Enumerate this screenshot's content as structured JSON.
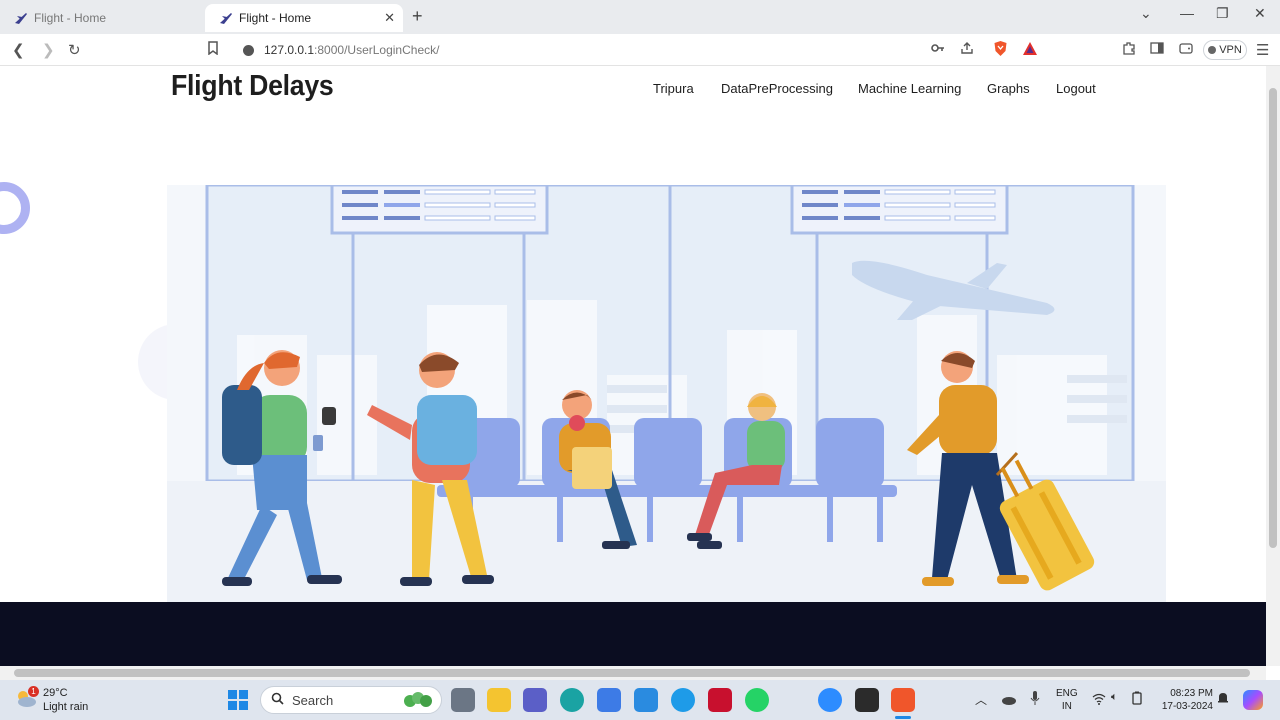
{
  "browser": {
    "tabs": [
      {
        "title": "Flight - Home",
        "active": false
      },
      {
        "title": "Flight - Home",
        "active": true
      }
    ],
    "url_host": "127.0.0.1",
    "url_path": ":8000/UserLoginCheck/",
    "vpn_label": "VPN"
  },
  "site": {
    "brand": "Flight Delays",
    "nav": [
      "Tripura",
      "DataPreProcessing",
      "Machine Learning",
      "Graphs",
      "Logout"
    ]
  },
  "taskbar": {
    "weather_temp": "29°C",
    "weather_desc": "Light rain",
    "weather_badge": "1",
    "search_placeholder": "Search",
    "lang_line1": "ENG",
    "lang_line2": "IN",
    "time": "08:23 PM",
    "date": "17-03-2024"
  },
  "colors": {
    "footer": "#0b0d21",
    "accent_ring": "#aeb2f2",
    "seat_blue": "#8fa6ea",
    "suitcase": "#f2c33f"
  }
}
